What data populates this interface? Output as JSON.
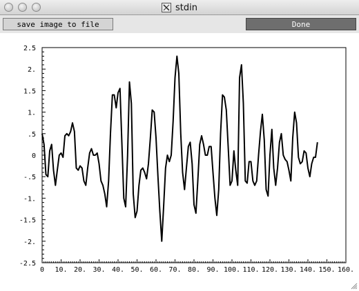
{
  "window": {
    "title": "stdin",
    "icon": "x11-icon"
  },
  "toolbar": {
    "save_label": "save image to file",
    "done_label": "Done"
  },
  "colors": {
    "window_bg": "#ffffff",
    "toolbar_bg": "#e6e6e6",
    "save_button_bg": "#d4d4d4",
    "done_button_bg": "#6e6e6e",
    "line": "#000000"
  },
  "chart_data": {
    "type": "line",
    "title": "",
    "xlabel": "",
    "ylabel": "",
    "xlim": [
      0,
      160
    ],
    "ylim": [
      -2.5,
      2.5
    ],
    "grid": false,
    "x_tick_labels": [
      "0",
      "10.",
      "20.",
      "30.",
      "40.",
      "50.",
      "60.",
      "70.",
      "80.",
      "90.",
      "100.",
      "110.",
      "120.",
      "130.",
      "140.",
      "150.",
      "160."
    ],
    "y_tick_labels": [
      {
        "value": -2.5,
        "label": "-2.5"
      },
      {
        "value": -2.0,
        "label": "-2."
      },
      {
        "value": -1.5,
        "label": "-1.5"
      },
      {
        "value": -1.0,
        "label": "-1."
      },
      {
        "value": -0.5,
        "label": "-.5"
      },
      {
        "value": 0.0,
        "label": "0"
      },
      {
        "value": 0.5,
        "label": ".5"
      },
      {
        "value": 1.0,
        "label": "1."
      },
      {
        "value": 1.5,
        "label": "1.5"
      },
      {
        "value": 2.0,
        "label": "2."
      },
      {
        "value": 2.5,
        "label": "2.5"
      }
    ],
    "series": [
      {
        "points": [
          [
            0,
            0.5
          ],
          [
            1,
            0.25
          ],
          [
            2,
            -0.45
          ],
          [
            3,
            -0.5
          ],
          [
            4,
            0.1
          ],
          [
            5,
            0.25
          ],
          [
            6,
            -0.35
          ],
          [
            7,
            -0.7
          ],
          [
            8,
            -0.35
          ],
          [
            9,
            0.0
          ],
          [
            10,
            0.05
          ],
          [
            11,
            -0.05
          ],
          [
            12,
            0.45
          ],
          [
            13,
            0.5
          ],
          [
            14,
            0.45
          ],
          [
            15,
            0.55
          ],
          [
            16,
            0.75
          ],
          [
            17,
            0.55
          ],
          [
            18,
            -0.3
          ],
          [
            19,
            -0.35
          ],
          [
            20,
            -0.25
          ],
          [
            21,
            -0.3
          ],
          [
            22,
            -0.6
          ],
          [
            23,
            -0.7
          ],
          [
            24,
            -0.3
          ],
          [
            25,
            0.05
          ],
          [
            26,
            0.15
          ],
          [
            27,
            0.0
          ],
          [
            28,
            0.0
          ],
          [
            29,
            0.05
          ],
          [
            30,
            -0.2
          ],
          [
            31,
            -0.6
          ],
          [
            32,
            -0.7
          ],
          [
            33,
            -0.9
          ],
          [
            34,
            -1.2
          ],
          [
            35,
            -0.6
          ],
          [
            36,
            0.5
          ],
          [
            37,
            1.4
          ],
          [
            38,
            1.4
          ],
          [
            39,
            1.1
          ],
          [
            40,
            1.45
          ],
          [
            41,
            1.55
          ],
          [
            42,
            0.3
          ],
          [
            43,
            -1.0
          ],
          [
            44,
            -1.2
          ],
          [
            45,
            0.0
          ],
          [
            46,
            1.7
          ],
          [
            47,
            1.2
          ],
          [
            48,
            -0.9
          ],
          [
            49,
            -1.45
          ],
          [
            50,
            -1.3
          ],
          [
            51,
            -0.7
          ],
          [
            52,
            -0.35
          ],
          [
            53,
            -0.3
          ],
          [
            54,
            -0.4
          ],
          [
            55,
            -0.55
          ],
          [
            56,
            -0.2
          ],
          [
            57,
            0.4
          ],
          [
            58,
            1.05
          ],
          [
            59,
            1.0
          ],
          [
            60,
            0.4
          ],
          [
            61,
            -0.5
          ],
          [
            62,
            -1.3
          ],
          [
            63,
            -2.0
          ],
          [
            64,
            -1.2
          ],
          [
            65,
            -0.3
          ],
          [
            66,
            0.0
          ],
          [
            67,
            -0.15
          ],
          [
            68,
            0.0
          ],
          [
            69,
            0.8
          ],
          [
            70,
            1.8
          ],
          [
            71,
            2.3
          ],
          [
            72,
            1.9
          ],
          [
            73,
            0.5
          ],
          [
            74,
            -0.4
          ],
          [
            75,
            -0.8
          ],
          [
            76,
            -0.3
          ],
          [
            77,
            0.2
          ],
          [
            78,
            0.3
          ],
          [
            79,
            -0.2
          ],
          [
            80,
            -1.15
          ],
          [
            81,
            -1.35
          ],
          [
            82,
            -0.6
          ],
          [
            83,
            0.25
          ],
          [
            84,
            0.45
          ],
          [
            85,
            0.25
          ],
          [
            86,
            0.0
          ],
          [
            87,
            0.0
          ],
          [
            88,
            0.2
          ],
          [
            89,
            0.2
          ],
          [
            90,
            -0.4
          ],
          [
            91,
            -1.0
          ],
          [
            92,
            -1.4
          ],
          [
            93,
            -0.8
          ],
          [
            94,
            0.5
          ],
          [
            95,
            1.4
          ],
          [
            96,
            1.35
          ],
          [
            97,
            1.05
          ],
          [
            98,
            0.2
          ],
          [
            99,
            -0.7
          ],
          [
            100,
            -0.6
          ],
          [
            101,
            0.1
          ],
          [
            102,
            -0.35
          ],
          [
            103,
            -0.7
          ],
          [
            104,
            1.8
          ],
          [
            105,
            2.1
          ],
          [
            106,
            1.2
          ],
          [
            107,
            -0.6
          ],
          [
            108,
            -0.65
          ],
          [
            109,
            -0.15
          ],
          [
            110,
            -0.15
          ],
          [
            111,
            -0.6
          ],
          [
            112,
            -0.7
          ],
          [
            113,
            -0.6
          ],
          [
            114,
            0.0
          ],
          [
            115,
            0.55
          ],
          [
            116,
            0.95
          ],
          [
            117,
            0.35
          ],
          [
            118,
            -0.8
          ],
          [
            119,
            -0.95
          ],
          [
            120,
            0.0
          ],
          [
            121,
            0.6
          ],
          [
            122,
            -0.3
          ],
          [
            123,
            -0.7
          ],
          [
            124,
            -0.3
          ],
          [
            125,
            0.3
          ],
          [
            126,
            0.5
          ],
          [
            127,
            0.0
          ],
          [
            128,
            -0.1
          ],
          [
            129,
            -0.15
          ],
          [
            130,
            -0.35
          ],
          [
            131,
            -0.6
          ],
          [
            132,
            0.4
          ],
          [
            133,
            1.0
          ],
          [
            134,
            0.75
          ],
          [
            135,
            -0.05
          ],
          [
            136,
            -0.2
          ],
          [
            137,
            -0.15
          ],
          [
            138,
            0.1
          ],
          [
            139,
            0.05
          ],
          [
            140,
            -0.3
          ],
          [
            141,
            -0.5
          ],
          [
            142,
            -0.2
          ],
          [
            143,
            -0.05
          ],
          [
            144,
            -0.05
          ],
          [
            145,
            0.3
          ]
        ]
      }
    ]
  }
}
